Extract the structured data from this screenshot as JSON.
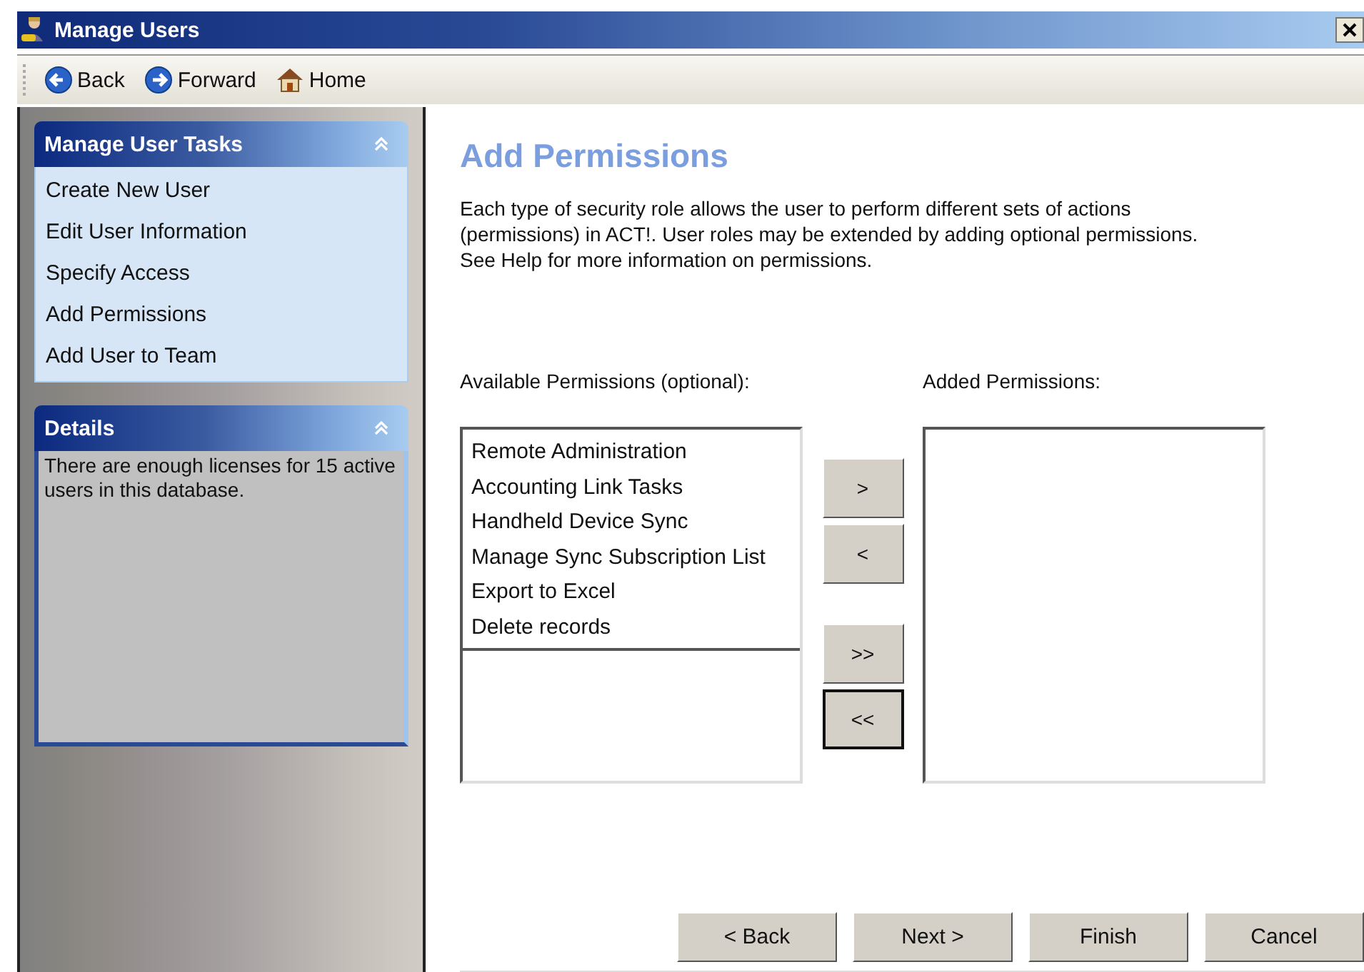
{
  "window": {
    "title": "Manage Users"
  },
  "toolbar": [
    {
      "label": "Back",
      "kind": "back"
    },
    {
      "label": "Forward",
      "kind": "forward"
    },
    {
      "label": "Home",
      "kind": "home"
    }
  ],
  "sidebar": {
    "tasks": {
      "title": "Manage User Tasks",
      "expanded": true,
      "items": [
        "Create New User",
        "Edit User Information",
        "Specify Access",
        "Add Permissions",
        "Add User to Team"
      ]
    },
    "details": {
      "title": "Details",
      "expanded": true,
      "text": "There are enough licenses for 15 active users in this database."
    }
  },
  "page": {
    "title": "Add Permissions",
    "description": "Each type of security role allows the user to perform different sets of actions (permissions) in ACT!. User roles may be extended by adding optional permissions. See Help for more information on permissions.",
    "available": {
      "label": "Available Permissions (optional):",
      "items": [
        "Remote Administration",
        "Accounting Link Tasks",
        "Handheld Device Sync",
        "Manage Sync Subscription List",
        "Export to Excel",
        "Delete records"
      ]
    },
    "added": {
      "label": "Added Permissions:"
    },
    "move_buttons": [
      {
        "label": ">",
        "focused": false
      },
      {
        "label": "<",
        "focused": false
      },
      {
        "label": ">>",
        "focused": false
      },
      {
        "label": "<<",
        "focused": true
      }
    ]
  },
  "footer_buttons": [
    "< Back",
    "Next >",
    "Finish",
    "Cancel"
  ]
}
